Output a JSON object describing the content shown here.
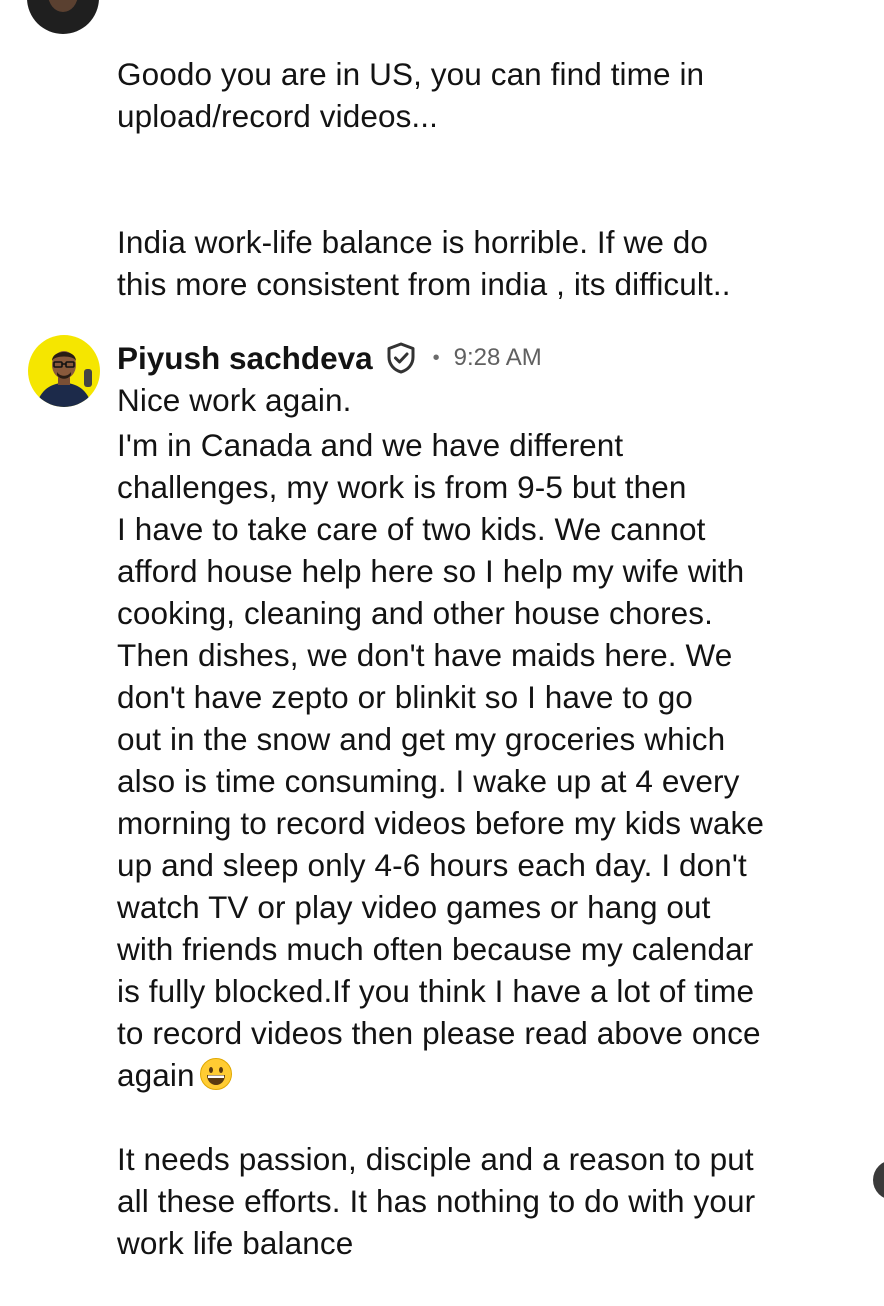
{
  "top_comment": {
    "paragraphs": [
      "Goodo you are in US, you can find time in\nupload/record videos...",
      "India work-life balance is horrible. If  we do\nthis more consistent from india , its difficult..",
      "Nice work again."
    ]
  },
  "reply": {
    "author": "Piyush sachdeva",
    "separator": "•",
    "timestamp": "9:28 AM",
    "body_main": "I'm in Canada and we have different\nchallenges, my work is from 9-5 but then\nI have to take care of two kids. We cannot\nafford house help here so I help my wife with\ncooking, cleaning and other house chores.\nThen dishes, we don't have maids here. We\ndon't have zepto or blinkit so I have to go\nout in the snow and get my groceries which\nalso is time consuming. I wake up at 4 every\nmorning to record videos before my kids wake\nup and sleep only 4-6 hours each day. I don't\nwatch TV or play video games or hang out\nwith friends much often because my calendar\nis fully blocked.If you think I have a lot of time\nto record videos then please read above once\nagain",
    "body_end": "It needs passion, disciple and a reason to put\nall these efforts. It has nothing to do with your\nwork life balance",
    "icons": {
      "verified": "verified-badge-icon",
      "emoji": "grinning-face-icon"
    }
  },
  "colors": {
    "text": "#131313",
    "meta": "#606060",
    "reply_avatar_bg": "#f5e600"
  }
}
